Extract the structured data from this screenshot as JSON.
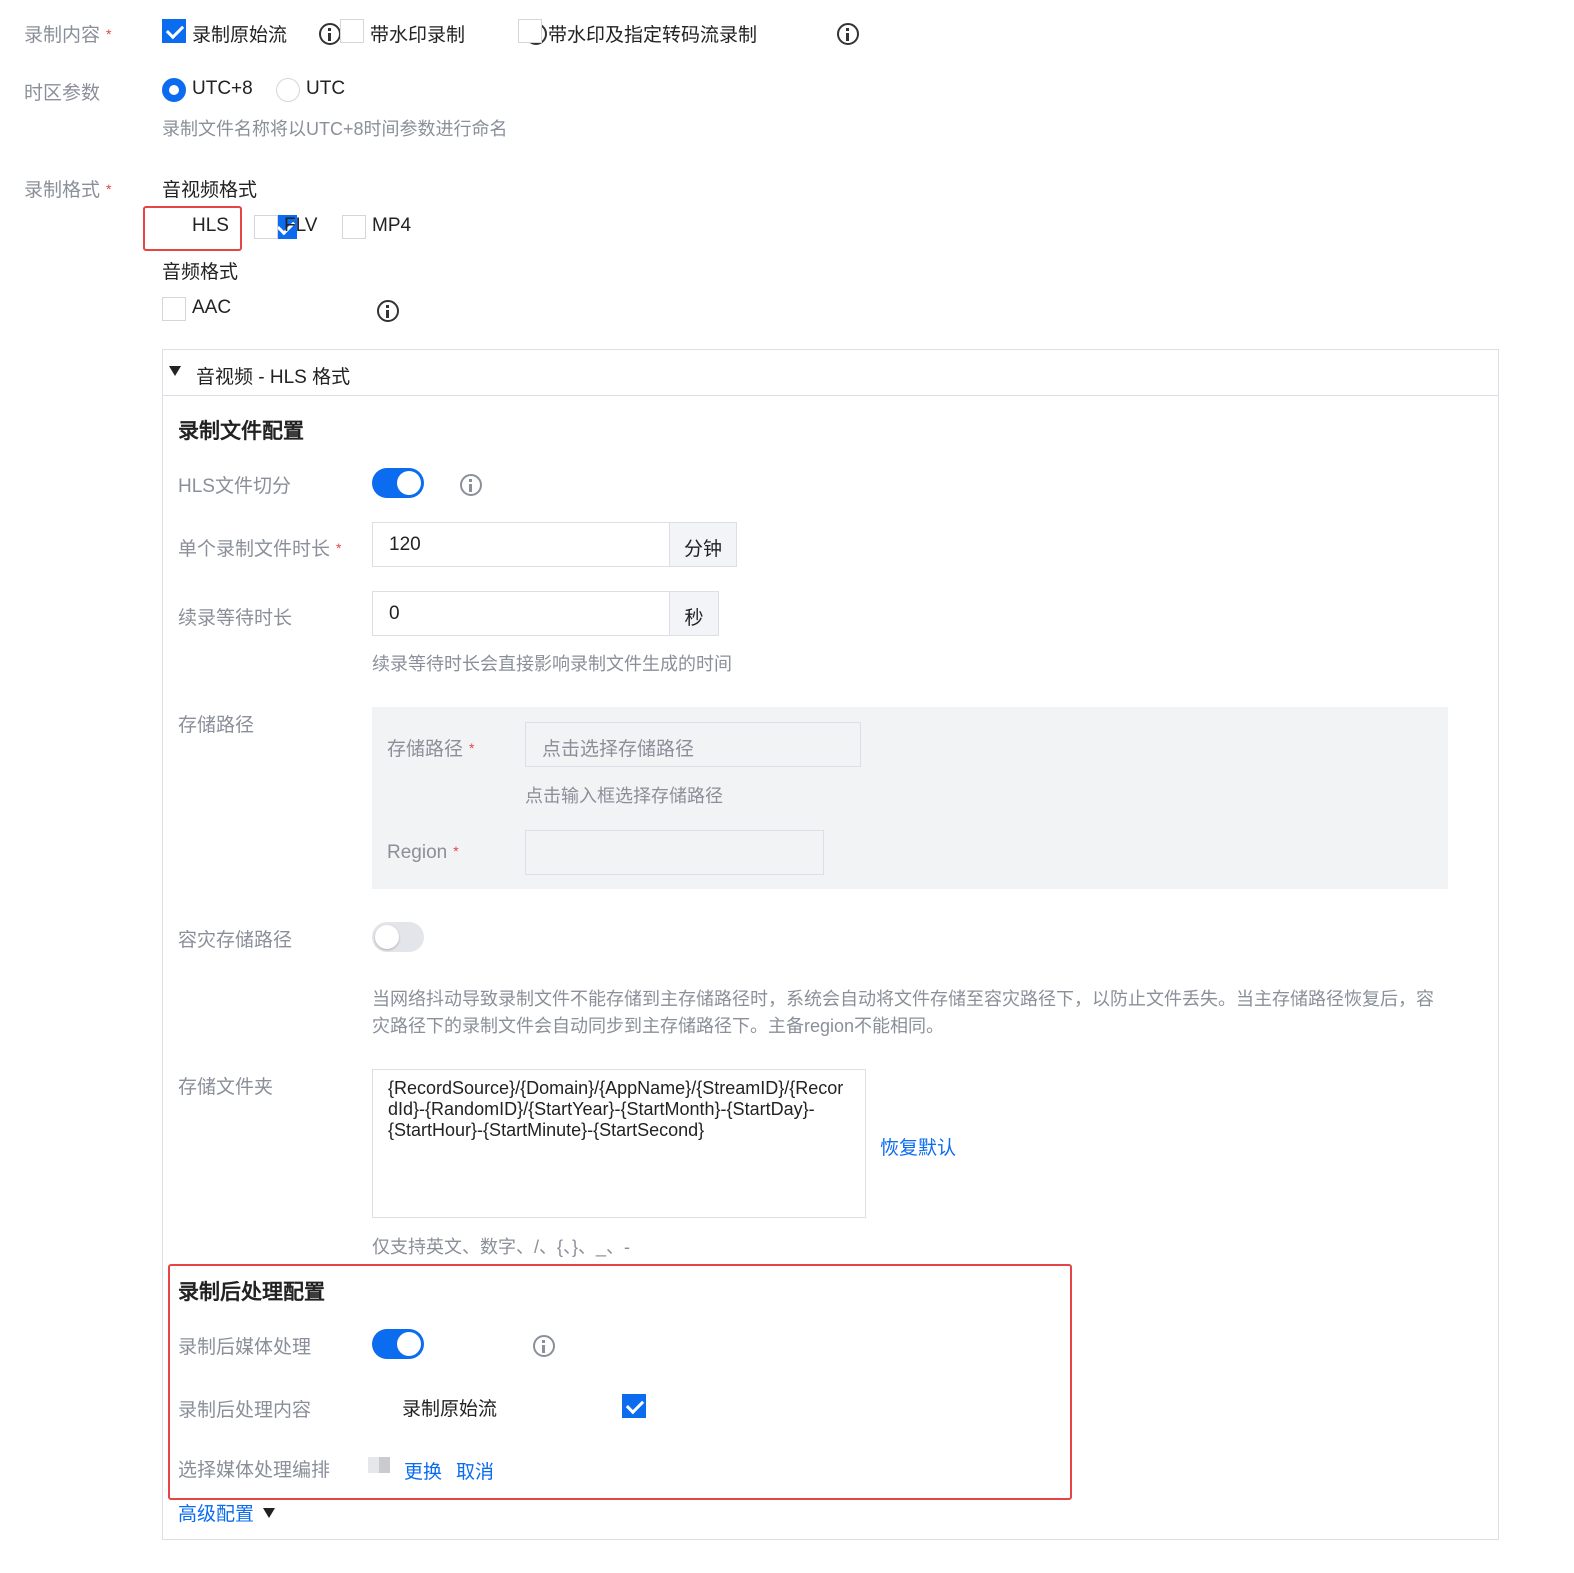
{
  "record_content": {
    "label": "录制内容",
    "options": [
      {
        "label": "录制原始流",
        "checked": true
      },
      {
        "label": "带水印录制",
        "checked": false
      },
      {
        "label": "带水印及指定转码流录制",
        "checked": false
      }
    ]
  },
  "timezone": {
    "label": "时区参数",
    "options": [
      {
        "label": "UTC+8",
        "selected": true
      },
      {
        "label": "UTC",
        "selected": false
      }
    ],
    "hint": "录制文件名称将以UTC+8时间参数进行命名"
  },
  "record_format": {
    "label": "录制格式",
    "av_title": "音视频格式",
    "av_options": [
      {
        "label": "HLS",
        "checked": true
      },
      {
        "label": "FLV",
        "checked": false
      },
      {
        "label": "MP4",
        "checked": false
      }
    ],
    "audio_title": "音频格式",
    "audio_options": [
      {
        "label": "AAC",
        "checked": false
      }
    ]
  },
  "panel": {
    "title": "音视频 - HLS 格式",
    "file_config": {
      "heading": "录制文件配置",
      "hls_split_label": "HLS文件切分",
      "hls_split_on": true,
      "duration_label": "单个录制文件时长",
      "duration_value": "120",
      "duration_unit": "分钟",
      "wait_label": "续录等待时长",
      "wait_value": "0",
      "wait_unit": "秒",
      "wait_hint": "续录等待时长会直接影响录制文件生成的时间",
      "storage_label": "存储路径",
      "storage_inner_label": "存储路径",
      "storage_placeholder": "点击选择存储路径",
      "storage_hint": "点击输入框选择存储路径",
      "region_label": "Region",
      "region_value": "",
      "dr_label": "容灾存储路径",
      "dr_on": false,
      "dr_hint_line1": "当网络抖动导致录制文件不能存储到主存储路径时，系统会自动将文件存储至容灾路径下，以防止文件丢失。当主存储路径恢复后，容",
      "dr_hint_line2": "灾路径下的录制文件会自动同步到主存储路径下。主备region不能相同。",
      "folder_label": "存储文件夹",
      "folder_line1": "{RecordSource}/{Domain}/{AppName}/{StreamID}/{Recor",
      "folder_line2": "dId}-{RandomID}/{StartYear}-{StartMonth}-{StartDay}-",
      "folder_line3": "{StartHour}-{StartMinute}-{StartSecond}",
      "restore_default": "恢复默认",
      "folder_hint": "仅支持英文、数字、/、{、}、_、-"
    },
    "post_process": {
      "heading": "录制后处理配置",
      "media_label": "录制后媒体处理",
      "media_on": true,
      "content_label": "录制后处理内容",
      "content_option": "录制原始流",
      "content_checked": true,
      "workflow_label": "选择媒体处理编排",
      "change_link": "更换",
      "cancel_link": "取消"
    },
    "advanced": "高级配置"
  },
  "colors": {
    "accent": "#0b6cf0",
    "highlight": "#e54545",
    "label_grey": "#8a8f99"
  }
}
